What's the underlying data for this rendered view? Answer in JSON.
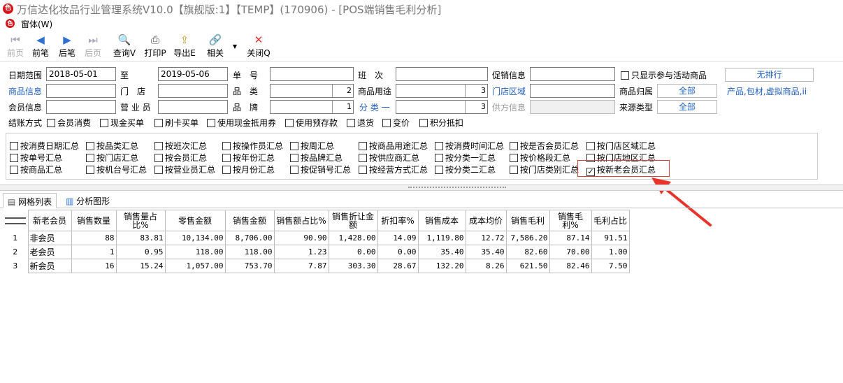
{
  "app": {
    "title": "万信达化妆品行业管理系统V10.0【旗舰版:1】【TEMP】(170906) - [POS端销售毛利分析]",
    "menu_window": "窗体(W)"
  },
  "toolbar": [
    {
      "label": "前页",
      "icon": "prev-page-icon",
      "enabled": false
    },
    {
      "label": "前笔",
      "icon": "prev-record-icon",
      "enabled": true
    },
    {
      "label": "后笔",
      "icon": "next-record-icon",
      "enabled": true
    },
    {
      "label": "后页",
      "icon": "next-page-icon",
      "enabled": false
    },
    {
      "label": "查询V",
      "icon": "query-icon",
      "enabled": true
    },
    {
      "label": "打印P",
      "icon": "printer-icon",
      "enabled": true
    },
    {
      "label": "导出E",
      "icon": "export-icon",
      "enabled": true
    },
    {
      "label": "相关",
      "icon": "link-icon",
      "enabled": true
    },
    {
      "label": "关闭Q",
      "icon": "close-icon",
      "enabled": true
    }
  ],
  "filters": {
    "date_range_label": "日期范围",
    "date_from": "2018-05-01",
    "to_label": "至",
    "date_to": "2019-05-06",
    "doc_no_label": "单　号",
    "shift_label": "班　次",
    "promo_label": "促销信息",
    "promo_only_label": "只显示参与活动商品",
    "sort_button": "无排行",
    "product_info_label": "商品信息",
    "store_label": "门　店",
    "category_label": "品　类",
    "category_value": "2",
    "usage_label": "商品用途",
    "usage_value": "3",
    "store_area_label": "门店区域",
    "product_owner_label": "商品归属",
    "product_owner_value": "全部",
    "product_owner_detail": "产品,包材,虚拟商品,ii",
    "member_label": "会员信息",
    "sales_clerk_label": "营 业 员",
    "brand_label": "品　牌",
    "brand_value": "1",
    "class_label": "分 类 一",
    "class_value": "3",
    "supplier_label": "供方信息",
    "source_type_label": "来源类型",
    "source_type_value": "全部",
    "settlement_label": "结账方式",
    "settlement_options": [
      "会员消费",
      "现金买单",
      "刷卡买单",
      "使用现金抵用券",
      "使用预存款",
      "退货",
      "变价",
      "积分抵扣"
    ]
  },
  "summary_options": [
    [
      "按消费日期汇总",
      "按品类汇总",
      "按班次汇总",
      "按操作员汇总",
      "按周汇总",
      "按商品用途汇总",
      "按消费时间汇总",
      "按是否会员汇总",
      "按门店区域汇总"
    ],
    [
      "按单号汇总",
      "按门店汇总",
      "按会员汇总",
      "按年份汇总",
      "按品牌汇总",
      "按供应商汇总",
      "按分类一汇总",
      "按价格段汇总",
      "按门店地区汇总"
    ],
    [
      "按商品汇总",
      "按机台号汇总",
      "按营业员汇总",
      "按月份汇总",
      "按促销号汇总",
      "按经营方式汇总",
      "按分类二汇总",
      "按门店类别汇总",
      "按新老会员汇总"
    ]
  ],
  "checked_summary": "按新老会员汇总",
  "tabs": [
    {
      "label": "网格列表",
      "icon": "document-icon"
    },
    {
      "label": "分析图形",
      "icon": "bar-chart-icon"
    }
  ],
  "grid": {
    "headers": [
      "新老会员",
      "销售数量",
      "销售量占比%",
      "零售金额",
      "销售金额",
      "销售额占比%",
      "销售折让金额",
      "折扣率%",
      "销售成本",
      "成本均价",
      "销售毛利",
      "销售毛利%",
      "毛利占比"
    ],
    "rows": [
      {
        "no": "1",
        "cells": [
          "非会员",
          "88",
          "83.81",
          "10,134.00",
          "8,706.00",
          "90.90",
          "1,428.00",
          "14.09",
          "1,119.80",
          "12.72",
          "7,586.20",
          "87.14",
          "91.51"
        ]
      },
      {
        "no": "2",
        "cells": [
          "老会员",
          "1",
          "0.95",
          "118.00",
          "118.00",
          "1.23",
          "0.00",
          "0.00",
          "35.40",
          "35.40",
          "82.60",
          "70.00",
          "1.00"
        ]
      },
      {
        "no": "3",
        "cells": [
          "新会员",
          "16",
          "15.24",
          "1,057.00",
          "753.70",
          "7.87",
          "303.30",
          "28.67",
          "132.20",
          "8.26",
          "621.50",
          "82.46",
          "7.50"
        ]
      }
    ]
  }
}
